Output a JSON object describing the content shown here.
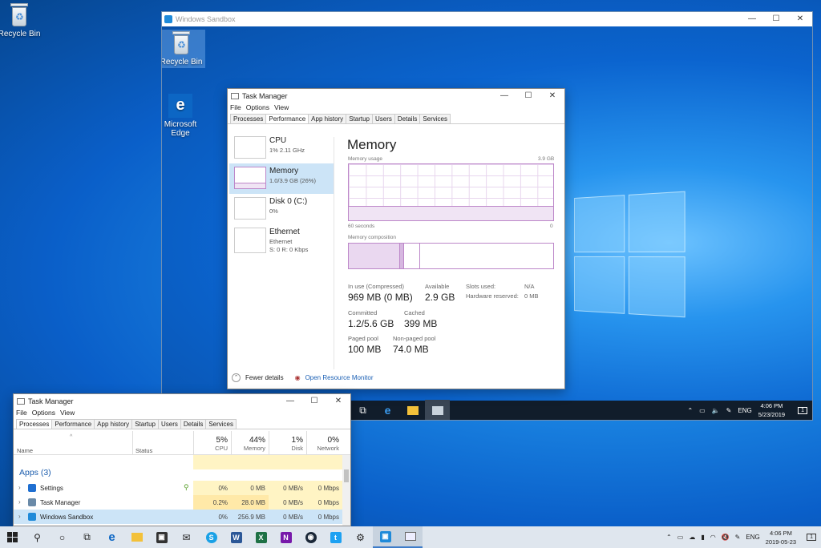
{
  "desktop": {
    "icons": [
      {
        "label": "Recycle Bin"
      }
    ]
  },
  "sandbox": {
    "title": "Windows Sandbox",
    "controls": {
      "minimize": "—",
      "maximize": "☐",
      "close": "✕"
    },
    "desktop_icons": [
      {
        "label": "Recycle Bin"
      },
      {
        "label": "Microsoft Edge"
      }
    ],
    "taskbar": {
      "lang": "ENG",
      "time": "4:06 PM",
      "date": "5/23/2019",
      "notifications": "1"
    }
  },
  "task_manager_inner": {
    "title": "Task Manager",
    "menu": [
      "File",
      "Options",
      "View"
    ],
    "tabs": [
      "Processes",
      "Performance",
      "App history",
      "Startup",
      "Users",
      "Details",
      "Services"
    ],
    "active_tab": "Performance",
    "side": [
      {
        "name": "CPU",
        "sub": "1% 2.11 GHz"
      },
      {
        "name": "Memory",
        "sub": "1.0/3.9 GB (26%)"
      },
      {
        "name": "Disk 0 (C:)",
        "sub": "0%"
      },
      {
        "name": "Ethernet",
        "sub": "Ethernet",
        "sub2": "S: 0 R: 0 Kbps"
      }
    ],
    "memory": {
      "heading": "Memory",
      "usage_label": "Memory usage",
      "usage_max": "3.9 GB",
      "axis_left": "60 seconds",
      "axis_right": "0",
      "composition_label": "Memory composition",
      "usage_fraction": 0.26,
      "stats": {
        "in_use_label": "In use (Compressed)",
        "in_use": "969 MB (0 MB)",
        "available_label": "Available",
        "available": "2.9 GB",
        "slots_label": "Slots used:",
        "slots": "N/A",
        "hw_reserved_label": "Hardware reserved:",
        "hw_reserved": "0 MB",
        "committed_label": "Committed",
        "committed": "1.2/5.6 GB",
        "cached_label": "Cached",
        "cached": "399 MB",
        "paged_label": "Paged pool",
        "paged": "100 MB",
        "nonpaged_label": "Non-paged pool",
        "nonpaged": "74.0 MB"
      }
    },
    "footer": {
      "fewer": "Fewer details",
      "monitor": "Open Resource Monitor"
    }
  },
  "task_manager_host": {
    "title": "Task Manager",
    "menu": [
      "File",
      "Options",
      "View"
    ],
    "tabs": [
      "Processes",
      "Performance",
      "App history",
      "Startup",
      "Users",
      "Details",
      "Services"
    ],
    "columns": {
      "name": "Name",
      "status": "Status",
      "cpu": {
        "pct": "5%",
        "label": "CPU"
      },
      "memory": {
        "pct": "44%",
        "label": "Memory"
      },
      "disk": {
        "pct": "1%",
        "label": "Disk"
      },
      "network": {
        "pct": "0%",
        "label": "Network"
      }
    },
    "group": "Apps (3)",
    "rows": [
      {
        "name": "Settings",
        "cpu": "0%",
        "mem": "0 MB",
        "disk": "0 MB/s",
        "net": "0 Mbps",
        "color": "#1f6fd1"
      },
      {
        "name": "Task Manager",
        "cpu": "0.2%",
        "mem": "28.0 MB",
        "disk": "0 MB/s",
        "net": "0 Mbps",
        "color": "#6a8aa8"
      },
      {
        "name": "Windows Sandbox",
        "cpu": "0%",
        "mem": "256.9 MB",
        "disk": "0 MB/s",
        "net": "0 Mbps",
        "color": "#1f8ad9"
      }
    ]
  },
  "taskbar": {
    "lang": "ENG",
    "time": "4:06 PM",
    "date": "2019-05-23",
    "notifications": "1"
  },
  "colors": {
    "accent": "#0078d7",
    "memory_chart": "#bd87c9"
  }
}
